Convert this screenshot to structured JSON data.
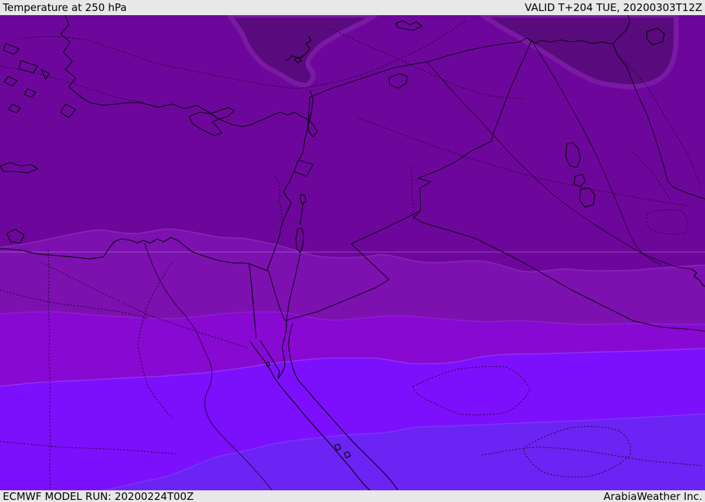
{
  "header": {
    "title": "Temperature at 250 hPa",
    "valid_time": "VALID T+204 TUE, 20200303T12Z"
  },
  "footer": {
    "model_run": "ECMWF MODEL RUN: 20200224T00Z",
    "credit": "ArabiaWeather Inc."
  },
  "map": {
    "description": "ECMWF 250 hPa temperature shading over Middle East / East Mediterranean",
    "palette": {
      "band_coldest_patch": "#590b7d",
      "band_patch_halo": "#7a1aa4",
      "band_north": "#6d079c",
      "band_mid1": "#7c11b0",
      "band_mid2": "#8709d2",
      "band_warm1": "#7c10fd",
      "band_warm2": "#6b24f3",
      "coastline": "#000000",
      "contour": "#1e0226",
      "gridline": "rgba(240,235,255,0.30)",
      "edge_c": "rgba(170,80,210,0.40)",
      "edge_d": "rgba(175,70,230,0.35)",
      "edge_e": "rgba(170,110,255,0.40)",
      "edge_f": "rgba(150,110,255,0.35)",
      "chrome_bg": "#e8e8e8",
      "chrome_text": "#000000"
    }
  }
}
